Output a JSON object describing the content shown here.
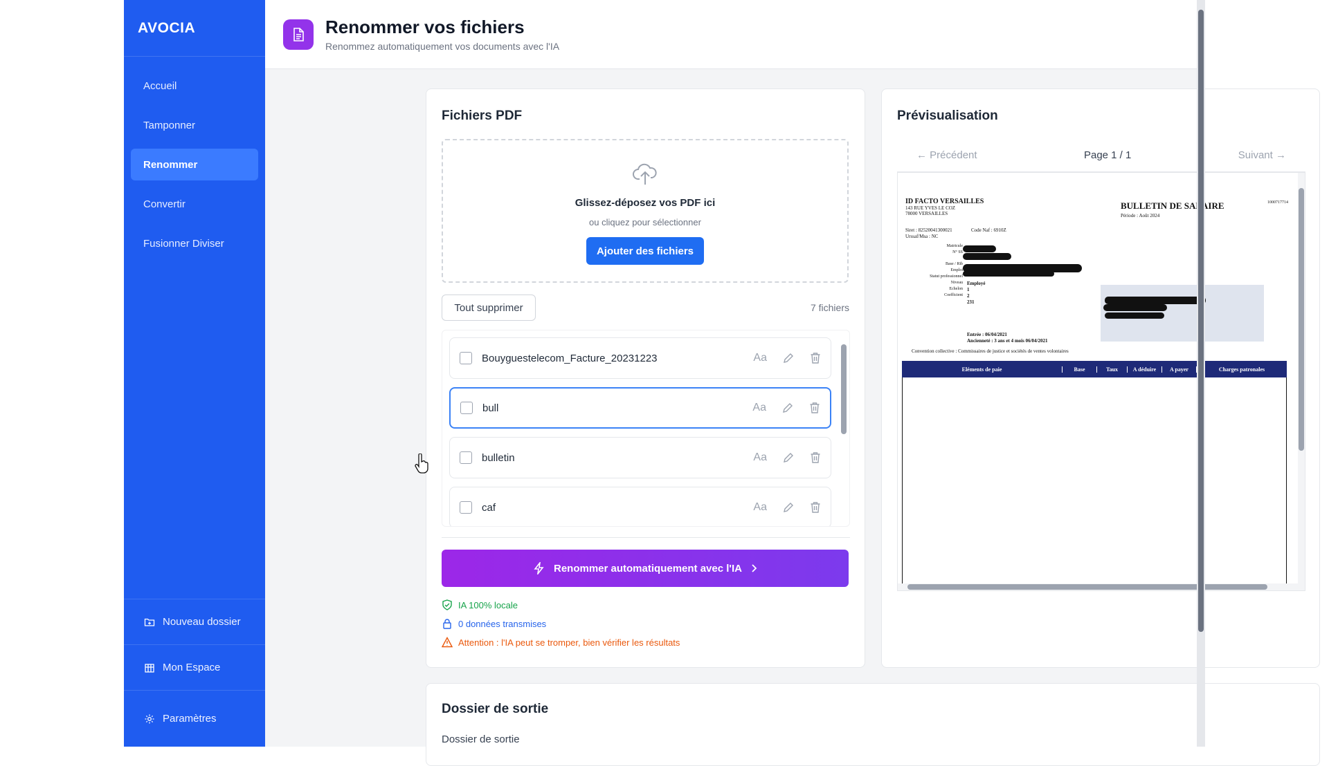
{
  "app": {
    "brand": "AVOCIA",
    "accent": "#1f5cf0",
    "nav": [
      {
        "label": "Accueil"
      },
      {
        "label": "Tamponner"
      },
      {
        "label": "Renommer",
        "active": true
      },
      {
        "label": "Convertir"
      },
      {
        "label": "Fusionner Diviser"
      }
    ],
    "bottom": [
      {
        "label": "Nouveau dossier",
        "icon": "folder-plus-icon"
      },
      {
        "label": "Mon Espace",
        "icon": "building-icon"
      },
      {
        "label": "Paramètres",
        "icon": "gear-icon"
      }
    ]
  },
  "header": {
    "title": "Renommer vos fichiers",
    "subtitle": "Renommez automatiquement vos documents avec l'IA",
    "icon": "document-icon"
  },
  "files_card": {
    "title": "Fichiers PDF",
    "dropzone": {
      "heading": "Glissez-déposez vos PDF ici",
      "hint": "ou cliquez pour sélectionner",
      "button": "Ajouter des fichiers"
    },
    "clear_button": "Tout supprimer",
    "count": "7 fichiers",
    "files": [
      {
        "name": "Bouyguestelecom_Facture_20231223",
        "case_label": "Aa"
      },
      {
        "name": "bull",
        "case_label": "Aa",
        "selected": true
      },
      {
        "name": "bulletin",
        "case_label": "Aa"
      },
      {
        "name": "caf",
        "case_label": "Aa"
      }
    ],
    "ai_button": "Renommer automatiquement avec l'IA",
    "notes": [
      {
        "text": "IA 100% locale",
        "color": "#16a34a",
        "icon": "shield-check-icon"
      },
      {
        "text": "0 données transmises",
        "color": "#2563eb",
        "icon": "lock-icon"
      },
      {
        "text": "Attention : l'IA peut se tromper, bien vérifier les résultats",
        "color": "#ea580c",
        "icon": "warning-icon"
      }
    ]
  },
  "preview": {
    "title": "Prévisualisation",
    "prev": "← Précédent",
    "page": "Page 1 / 1",
    "next": "Suivant →",
    "doc": {
      "company": "ID FACTO VERSAILLES",
      "address1": "143 RUE YVES LE COZ",
      "address2": "78000 VERSAILLES",
      "doc_title": "BULLETIN DE SALAIRE",
      "period": "Période : Août 2024",
      "ref": "1000717714",
      "siret": "Siret : 82520041300021",
      "naf": "Code Naf : 6910Z",
      "urssaf": "Urssaf/Msa : NC",
      "fields": [
        {
          "k": "Matricule",
          "v": ""
        },
        {
          "k": "N° SS",
          "v": ""
        },
        {
          "k": "Base / Rib",
          "v": ""
        },
        {
          "k": "Emploi",
          "v": ""
        },
        {
          "k": "Statut professionnel",
          "v": "Employé"
        },
        {
          "k": "Niveau",
          "v": "1"
        },
        {
          "k": "Echelon",
          "v": "2"
        },
        {
          "k": "Coefficient",
          "v": "231"
        }
      ],
      "entree": "Entrée : 06/04/2021",
      "anciennete": "Ancienneté : 3 ans et 4 mois   06/04/2021",
      "convention": "Convention collective : Commissaires de justice et sociétés de ventes volontaires",
      "columns": [
        "Eléments de paie",
        "Base",
        "Taux",
        "A déduire",
        "A payer",
        "Charges patronales"
      ]
    }
  },
  "output": {
    "title": "Dossier de sortie",
    "label": "Dossier de sortie"
  }
}
